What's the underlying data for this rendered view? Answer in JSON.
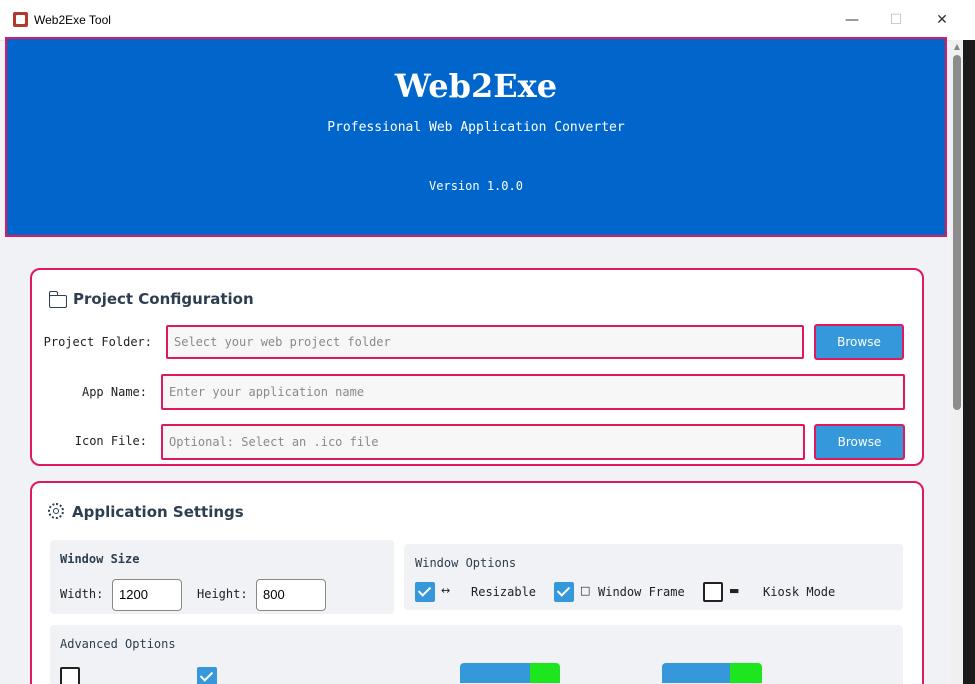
{
  "window": {
    "title": "Web2Exe Tool",
    "minimize_glyph": "—",
    "maximize_glyph": "☐",
    "close_glyph": "✕"
  },
  "header": {
    "title": "Web2Exe",
    "subtitle": "Professional Web Application Converter",
    "version": "Version 1.0.0"
  },
  "project_config": {
    "title": "Project Configuration",
    "icon": "folder-icon",
    "project_folder_label": "Project Folder:",
    "project_folder_placeholder": "Select your web project folder",
    "project_folder_value": "",
    "browse_label": "Browse",
    "app_name_label": "App Name:",
    "app_name_placeholder": "Enter your application name",
    "app_name_value": "",
    "icon_file_label": "Icon File:",
    "icon_file_placeholder": "Optional: Select an .ico file",
    "icon_file_value": "",
    "icon_browse_label": "Browse"
  },
  "app_settings": {
    "title": "Application Settings",
    "icon": "gear-icon",
    "window_size": {
      "title": "Window Size",
      "width_label": "Width:",
      "width_value": "1200",
      "height_label": "Height:",
      "height_value": "800"
    },
    "window_options": {
      "title": "Window Options",
      "resizable": {
        "label": "Resizable",
        "checked": true,
        "glyph": "↔"
      },
      "window_frame": {
        "label": "Window Frame",
        "checked": true,
        "glyph": "□"
      },
      "kiosk_mode": {
        "label": "Kiosk Mode",
        "checked": false,
        "glyph": "▬"
      }
    },
    "advanced_options": {
      "title": "Advanced Options"
    }
  },
  "colors": {
    "header_bg": "#0066cc",
    "accent_border": "#e0185e",
    "button_blue": "#3498db",
    "build_green": "#1ee61e",
    "heading_text": "#2c3e50"
  }
}
